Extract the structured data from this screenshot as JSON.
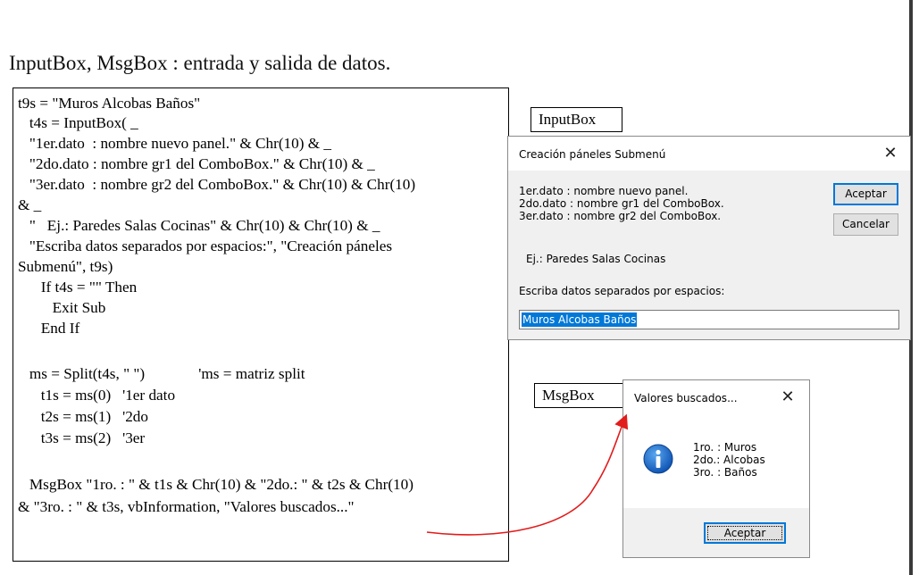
{
  "heading": "InputBox, MsgBox : entrada y salida de datos.",
  "code_lines": [
    "t9s = \"Muros Alcobas Baños\"",
    "   t4s = InputBox( _",
    "   \"1er.dato  : nombre nuevo panel.\" & Chr(10) & _",
    "   \"2do.dato : nombre gr1 del ComboBox.\" & Chr(10) & _",
    "   \"3er.dato  : nombre gr2 del ComboBox.\" & Chr(10) & Chr(10)",
    "& _",
    "   \"   Ej.: Paredes Salas Cocinas\" & Chr(10) & Chr(10) & _",
    "   \"Escriba datos separados por espacios:\", \"Creación páneles",
    "Submenú\", t9s)",
    "      If t4s = \"\" Then",
    "         Exit Sub",
    "      End If",
    "",
    "   ms = Split(t4s, \" \")              'ms = matriz split",
    "      t1s = ms(0)   '1er dato",
    "      t2s = ms(1)   '2do",
    "      t3s = ms(2)   '3er",
    "",
    "   MsgBox \"1ro. : \" & t1s & Chr(10) & \"2do.: \" & t2s & Chr(10)",
    "& \"3ro. : \" & t3s, vbInformation, \"Valores buscados...\""
  ],
  "labels": {
    "inputbox": "InputBox",
    "msgbox": "MsgBox"
  },
  "input_dialog": {
    "title": "Creación páneles Submenú",
    "close": "✕",
    "prompt_lines": [
      "1er.dato  : nombre nuevo panel.",
      "2do.dato : nombre gr1 del ComboBox.",
      "3er.dato  : nombre gr2 del ComboBox."
    ],
    "example": "Ej.: Paredes Salas Cocinas",
    "instruction": "Escriba datos separados por espacios:",
    "accept_button": "Aceptar",
    "cancel_button": "Cancelar",
    "field_value": "Muros Alcobas Baños"
  },
  "msg_dialog": {
    "title": "Valores buscados...",
    "close": "✕",
    "icon": "information-icon",
    "lines": [
      "1ro. : Muros",
      "2do.: Alcobas",
      "3ro. : Baños"
    ],
    "ok_button": "Aceptar"
  },
  "colors": {
    "arrow": "#e21b1b",
    "selection": "#0078d7",
    "dialog_bg": "#f0f0f0"
  }
}
